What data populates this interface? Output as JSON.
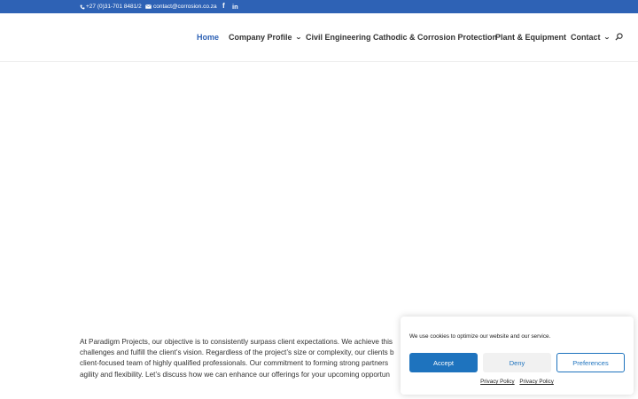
{
  "topbar": {
    "phone": "+27 (0)31-701 8481/2",
    "email": "contact@corrosion.co.za",
    "social": [
      {
        "icon": "facebook-icon",
        "glyph": "f"
      },
      {
        "icon": "linkedin-icon",
        "glyph": "in"
      }
    ]
  },
  "nav": {
    "items": [
      {
        "label": "Home",
        "active": true
      },
      {
        "label": "Company Profile",
        "dropdown": true,
        "chevron": "⌄"
      },
      {
        "label": "Civil Engineering"
      },
      {
        "label": "Cathodic & Corrosion Protection"
      },
      {
        "label": "Plant & Equipment"
      },
      {
        "label": "Contact",
        "dropdown": true,
        "chevron": "⌄"
      }
    ],
    "search_icon": "search-icon"
  },
  "content": {
    "lines": [
      "At Paradigm Projects, our objective is to consistently surpass client expectations. We achieve this",
      "challenges and fulfill the client’s vision. Regardless of the project’s size or complexity, our clients b",
      "client-focused team of highly qualified professionals. Our commitment to forming strong partners",
      "agility and flexibility. Let’s discuss how we can enhance our offerings for your upcoming opportun"
    ]
  },
  "cookie_banner": {
    "message": "We use cookies to optimize our website and our service.",
    "accept": "Accept",
    "deny": "Deny",
    "preferences": "Preferences",
    "links": [
      "Privacy Policy",
      "Privacy Policy"
    ]
  },
  "colors": {
    "topbar": "#2e62b5",
    "accent": "#1e73be",
    "nav_text": "#333333"
  }
}
